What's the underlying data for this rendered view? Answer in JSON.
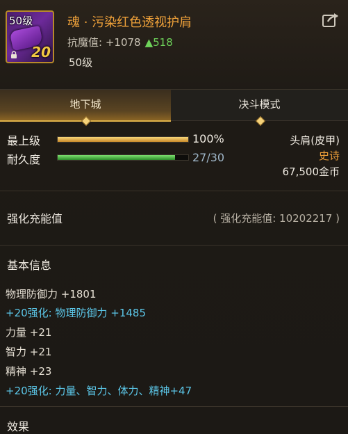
{
  "item": {
    "icon_level": "50级",
    "reinforce": "20",
    "title": "魂 · 污染红色透视护肩",
    "resist_label": "抗魔值:",
    "resist_value": "+1078",
    "resist_up": "▲518",
    "level": "50级",
    "share_icon": "share-icon"
  },
  "tabs": [
    {
      "label": "地下城",
      "active": true
    },
    {
      "label": "决斗模式",
      "active": false
    }
  ],
  "stats": {
    "top_grade_label": "最上级",
    "top_grade_value": "100%",
    "top_grade_fraction": 1.0,
    "durability_label": "耐久度",
    "durability_value": "27/30",
    "durability_fraction": 0.9,
    "slot": "头肩(皮甲)",
    "rarity": "史诗",
    "price": "67,500金币"
  },
  "charge": {
    "title": "强化充能值",
    "value_text": "( 强化充能值: 10202217 )"
  },
  "basic_info": {
    "title": "基本信息",
    "lines": [
      {
        "text": "物理防御力 +1801",
        "highlight": false
      },
      {
        "text": "+20强化: 物理防御力 +1485",
        "highlight": true
      },
      {
        "text": "力量 +21",
        "highlight": false
      },
      {
        "text": "智力 +21",
        "highlight": false
      },
      {
        "text": "精神 +23",
        "highlight": false
      },
      {
        "text": "+20强化: 力量、智力、体力、精神+47",
        "highlight": true
      }
    ]
  },
  "effects": {
    "title": "效果"
  },
  "colors": {
    "title_orange": "#f0a23a",
    "rarity_epic": "#f1a13a",
    "reinforce_cyan": "#5cc8ea",
    "up_green": "#6ed35a",
    "tab_gold": "#e0b24a"
  }
}
